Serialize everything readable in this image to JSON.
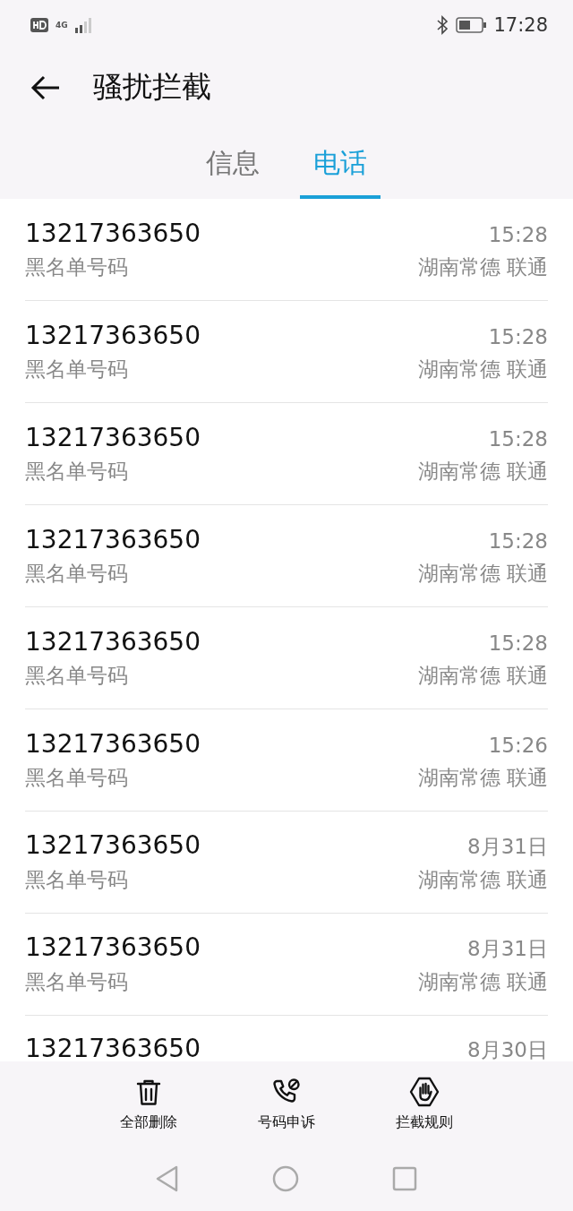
{
  "status_bar": {
    "network": "4G",
    "time": "17:28"
  },
  "header": {
    "title": "骚扰拦截"
  },
  "tabs": [
    {
      "label": "信息",
      "selected": false
    },
    {
      "label": "电话",
      "selected": true
    }
  ],
  "calls": [
    {
      "number": "13217363650",
      "time": "15:28",
      "label": "黑名单号码",
      "location": "湖南常德 联通"
    },
    {
      "number": "13217363650",
      "time": "15:28",
      "label": "黑名单号码",
      "location": "湖南常德 联通"
    },
    {
      "number": "13217363650",
      "time": "15:28",
      "label": "黑名单号码",
      "location": "湖南常德 联通"
    },
    {
      "number": "13217363650",
      "time": "15:28",
      "label": "黑名单号码",
      "location": "湖南常德 联通"
    },
    {
      "number": "13217363650",
      "time": "15:28",
      "label": "黑名单号码",
      "location": "湖南常德 联通"
    },
    {
      "number": "13217363650",
      "time": "15:26",
      "label": "黑名单号码",
      "location": "湖南常德 联通"
    },
    {
      "number": "13217363650",
      "time": "8月31日",
      "label": "黑名单号码",
      "location": "湖南常德 联通"
    },
    {
      "number": "13217363650",
      "time": "8月31日",
      "label": "黑名单号码",
      "location": "湖南常德 联通"
    },
    {
      "number": "13217363650",
      "time": "8月30日"
    }
  ],
  "actions": [
    {
      "kind": "delete",
      "label": "全部删除"
    },
    {
      "kind": "appeal",
      "label": "号码申诉"
    },
    {
      "kind": "rules",
      "label": "拦截规则"
    }
  ]
}
